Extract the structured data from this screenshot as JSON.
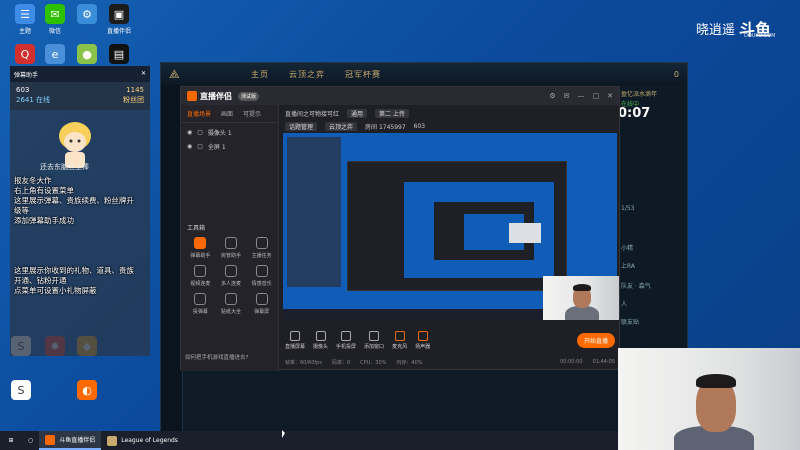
{
  "desktop_icons": [
    {
      "label": "主题",
      "color": "#3f8be8",
      "glyph": "☰",
      "icon": "theme-icon"
    },
    {
      "label": "微信",
      "color": "#2dc100",
      "glyph": "✉",
      "icon": "wechat-icon"
    },
    {
      "label": "",
      "color": "#3a8dd8",
      "glyph": "⚙",
      "icon": "settings-icon"
    },
    {
      "label": "直播伴侣",
      "color": "#1c1c1c",
      "glyph": "▣",
      "icon": "app-icon"
    },
    {
      "label": "",
      "color": "#d32f2f",
      "glyph": "Q",
      "icon": "qq-icon"
    },
    {
      "label": "",
      "color": "#4a90d9",
      "glyph": "e",
      "icon": "browser-icon"
    },
    {
      "label": "",
      "color": "#8bc34a",
      "glyph": "●",
      "icon": "ball-icon"
    },
    {
      "label": "",
      "color": "#111111",
      "glyph": "▤",
      "icon": "lol-icon"
    },
    {
      "label": "",
      "color": "#ffffff",
      "glyph": "S",
      "icon": "s-app-icon"
    },
    {
      "label": "",
      "color": "#e53935",
      "glyph": "✸",
      "icon": "star-app-icon"
    },
    {
      "label": "",
      "color": "#f5a623",
      "glyph": "◆",
      "icon": "game-icon"
    },
    {
      "label": "",
      "color": "#ffffff",
      "glyph": "S",
      "icon": "s-app2-icon"
    },
    {
      "label": "",
      "color": "#ff6a00",
      "glyph": "◐",
      "icon": "live-icon"
    }
  ],
  "overlay": {
    "header_left": "弹幕助手",
    "stats": [
      "603",
      "1145",
      "2641 在线",
      "粉丝团"
    ],
    "caption": "还去东脑丝上棒",
    "lines_a": [
      "报友冬大作",
      "右上角有设置菜单",
      "这里展示弹幕、贵族续费、粉丝牌升",
      "级等",
      "添加弹幕助手成功"
    ],
    "lines_b": [
      "这里展示你收到的礼物、道具、贵族",
      "开通、钻粉开通",
      "点菜单可设置小礼物屏蔽"
    ]
  },
  "game": {
    "tabs": [
      "主页",
      "云顶之弈",
      "冠军杯赛"
    ],
    "right_title": "盈忆派水滴年",
    "right_sub": "在线中",
    "clock": "0:07",
    "right_rows": [
      "1/53",
      "小精",
      "上RA",
      "队友 · 森气",
      "人",
      "联友贴"
    ],
    "coins": "0"
  },
  "app": {
    "title": "直播伴侣",
    "tag": "测试版",
    "left_tabs": [
      "直播场景",
      "画面",
      "可提示"
    ],
    "scenes": [
      "摄像头 1",
      "全屏 1"
    ],
    "tools_title": "工具箱",
    "tools": [
      "弹幕助手",
      "房管助手",
      "主播任务",
      "视频连麦",
      "多人连麦",
      "情感音乐",
      "投弹幕",
      "贴纸大全",
      "弹幕屏"
    ],
    "stream_title": "直播间之可物接可红",
    "category": "通用",
    "edit_label": "第二 上传",
    "row2": [
      "话题管理",
      "云顶之弈",
      "房间 1745997",
      "603"
    ],
    "bottom": [
      "直播屏幕",
      "摄像头",
      "手机投屏",
      "添加窗口",
      "麦克风",
      "扬声器"
    ],
    "go_live": "开始直播",
    "status": [
      "帧率：60/60fps",
      "码率：0",
      "CPU：30%",
      "内存：40%",
      "00:00:00",
      "01:44:05"
    ],
    "notice": "如何把手机游戏直播进去?"
  },
  "watermark": {
    "name": "晓逍遥",
    "logo": "斗鱼",
    "sub": "DOUYU.COM"
  },
  "taskbar": {
    "items": [
      "斗鱼直播伴侣",
      "League of Legends"
    ]
  }
}
